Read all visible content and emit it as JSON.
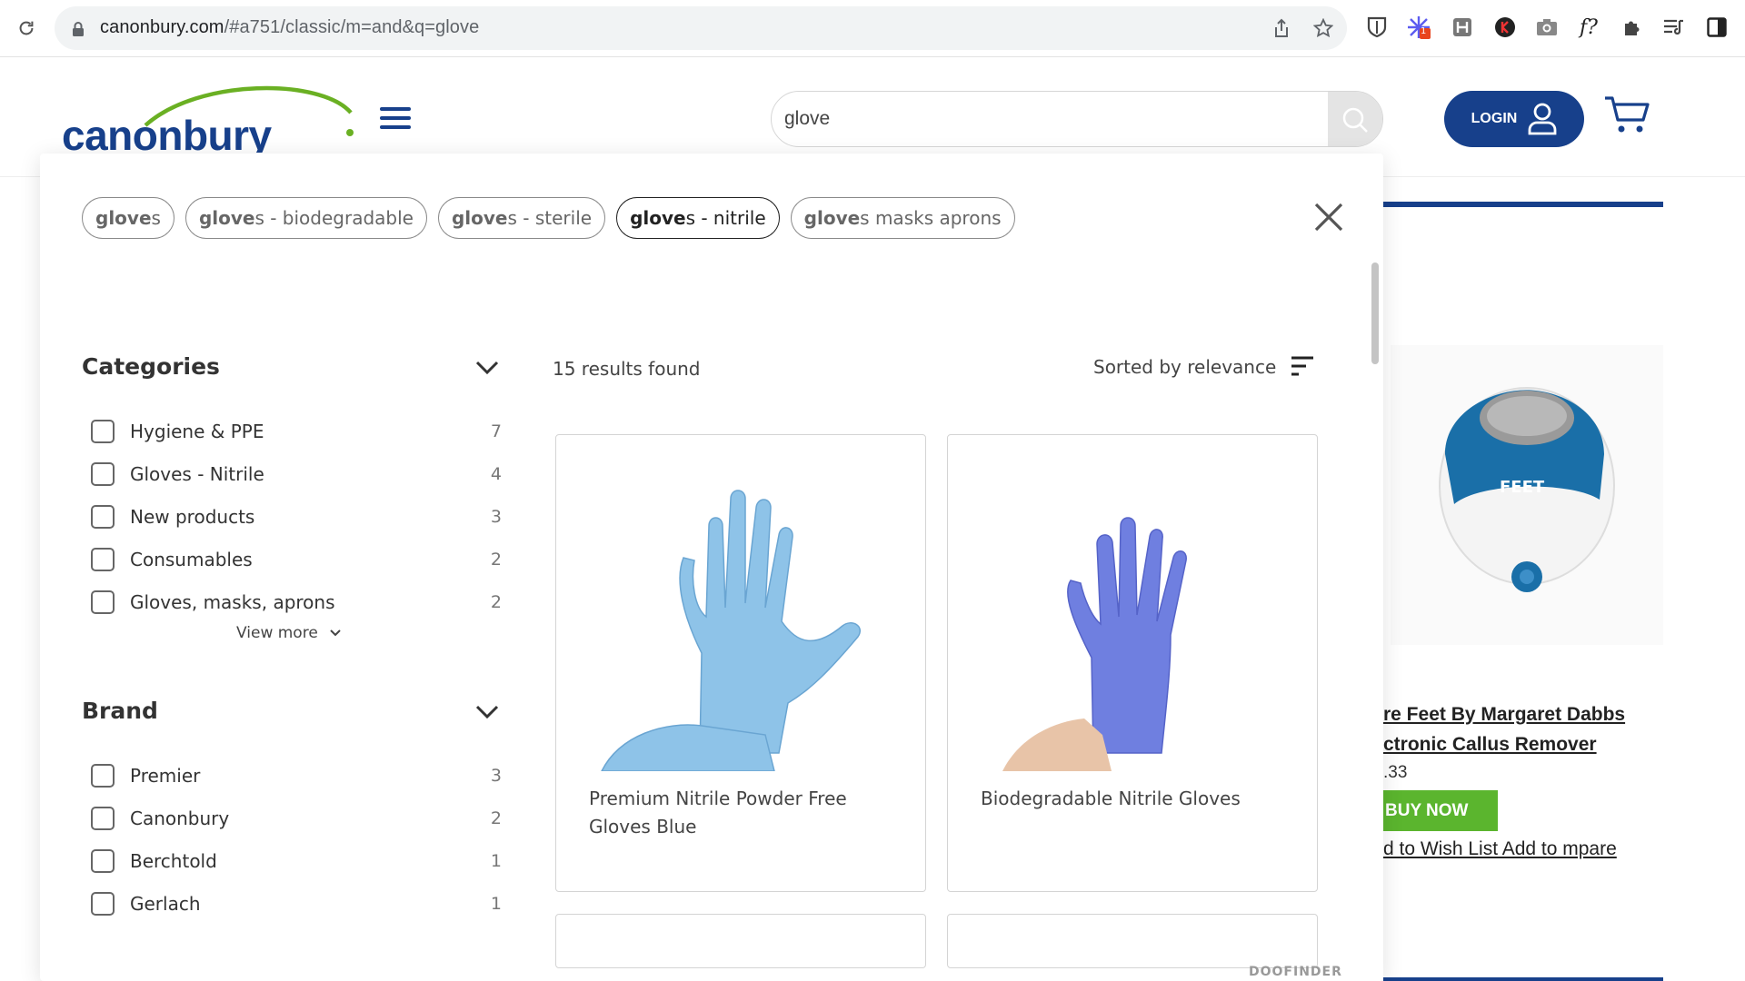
{
  "browser": {
    "url_host": "canonbury.com",
    "url_path": "/#a751/classic/m=and&q=glove",
    "extension_badge": "1",
    "ext_f_label": "f?"
  },
  "header": {
    "logo_text": "canonbury",
    "search_value": "glove",
    "login_label": "LOGIN"
  },
  "suggestions": [
    {
      "bold": "glove",
      "rest": "s"
    },
    {
      "bold": "glove",
      "rest": "s - biodegradable"
    },
    {
      "bold": "glove",
      "rest": "s - sterile"
    },
    {
      "bold": "glove",
      "rest": "s - nitrile",
      "active": true
    },
    {
      "bold": "glove",
      "rest": "s masks aprons"
    }
  ],
  "facets": {
    "categories": {
      "title": "Categories",
      "options": [
        {
          "label": "Hygiene & PPE",
          "count": "7"
        },
        {
          "label": "Gloves - Nitrile",
          "count": "4"
        },
        {
          "label": "New products",
          "count": "3"
        },
        {
          "label": "Consumables",
          "count": "2"
        },
        {
          "label": "Gloves, masks, aprons",
          "count": "2"
        }
      ],
      "view_more": "View more"
    },
    "brand": {
      "title": "Brand",
      "options": [
        {
          "label": "Premier",
          "count": "3"
        },
        {
          "label": "Canonbury",
          "count": "2"
        },
        {
          "label": "Berchtold",
          "count": "1"
        },
        {
          "label": "Gerlach",
          "count": "1"
        }
      ]
    }
  },
  "results": {
    "count_text": "15 results found",
    "sort_label": "Sorted by relevance",
    "items": [
      {
        "name": "Premium Nitrile Powder Free Gloves Blue",
        "color": "#8ec3e8"
      },
      {
        "name": "Biodegradable Nitrile Gloves",
        "color": "#6f7fe0"
      }
    ]
  },
  "background_product": {
    "title": "re Feet By Margaret Dabbs ctronic Callus Remover",
    "price": ".33",
    "buy_label": "BUY NOW",
    "links": "d to Wish List Add to mpare",
    "brand_mark": "FEET"
  },
  "footer": {
    "powered_by": "DOOFINDER"
  },
  "colors": {
    "brand_blue": "#17408b",
    "brand_green": "#6ab023",
    "buy_green": "#5bb52e"
  }
}
